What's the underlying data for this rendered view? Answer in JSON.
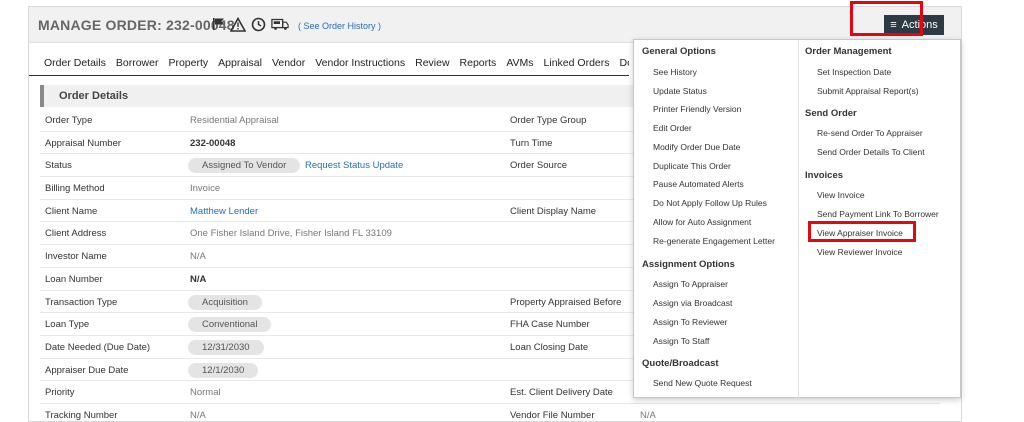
{
  "header": {
    "title": "MANAGE ORDER: 232-00048",
    "see_history": "( See Order History )",
    "actions_label": "Actions"
  },
  "tabs": [
    "Order Details",
    "Borrower",
    "Property",
    "Appraisal",
    "Vendor",
    "Vendor Instructions",
    "Review",
    "Reports",
    "AVMs",
    "Linked Orders",
    "Docu"
  ],
  "section_title": "Order Details",
  "rows": [
    {
      "label": "Order Type",
      "value": "Residential Appraisal",
      "right_label": "Order Type Group"
    },
    {
      "label": "Appraisal Number",
      "value": "232-00048",
      "right_label": "Turn Time"
    },
    {
      "label": "Status",
      "value": "Assigned To Vendor",
      "link": "Request Status Update",
      "right_label": "Order Source"
    },
    {
      "label": "Billing Method",
      "value": "Invoice"
    },
    {
      "label": "Client Name",
      "value": "Matthew Lender",
      "right_label": "Client Display Name"
    },
    {
      "label": "Client Address",
      "value": "One Fisher Island Drive, Fisher Island FL 33109"
    },
    {
      "label": "Investor Name",
      "value": "N/A"
    },
    {
      "label": "Loan Number",
      "value": "N/A"
    },
    {
      "label": "Transaction Type",
      "value": "Acquisition",
      "right_label": "Property Appraised Before"
    },
    {
      "label": "Loan Type",
      "value": "Conventional",
      "right_label": "FHA Case Number"
    },
    {
      "label": "Date Needed (Due Date)",
      "value": "12/31/2030",
      "right_label": "Loan Closing Date"
    },
    {
      "label": "Appraiser Due Date",
      "value": "12/1/2030"
    },
    {
      "label": "Priority",
      "value": "Normal",
      "right_label": "Est. Client Delivery Date"
    },
    {
      "label": "Tracking Number",
      "value": "N/A",
      "right_label": "Vendor File Number",
      "right_value": "N/A"
    }
  ],
  "menu": {
    "general_options": {
      "heading": "General Options",
      "items": [
        "See History",
        "Update Status",
        "Printer Friendly Version",
        "Edit Order",
        "Modify Order Due Date",
        "Duplicate This Order",
        "Pause Automated Alerts",
        "Do Not Apply Follow Up Rules",
        "Allow for Auto Assignment",
        "Re-generate Engagement Letter"
      ]
    },
    "assignment_options": {
      "heading": "Assignment Options",
      "items": [
        "Assign To Appraiser",
        "Assign via Broadcast",
        "Assign To Reviewer",
        "Assign To Staff"
      ]
    },
    "quote_broadcast": {
      "heading": "Quote/Broadcast",
      "items": [
        "Send New Quote Request"
      ]
    },
    "order_management": {
      "heading": "Order Management",
      "items": [
        "Set Inspection Date",
        "Submit Appraisal Report(s)"
      ]
    },
    "send_order": {
      "heading": "Send Order",
      "items": [
        "Re-send Order To Appraiser",
        "Send Order Details To Client"
      ]
    },
    "invoices": {
      "heading": "Invoices",
      "items": [
        "View Invoice",
        "Send Payment Link To Borrower",
        "View Appraiser Invoice",
        "View Reviewer Invoice"
      ]
    }
  },
  "colors": {
    "accent": "#2a6db6",
    "actions_bg": "#2d3a45",
    "highlight": "#e30613"
  },
  "icons": [
    "flag-icon",
    "warning-icon",
    "clock-icon",
    "truck-icon"
  ]
}
